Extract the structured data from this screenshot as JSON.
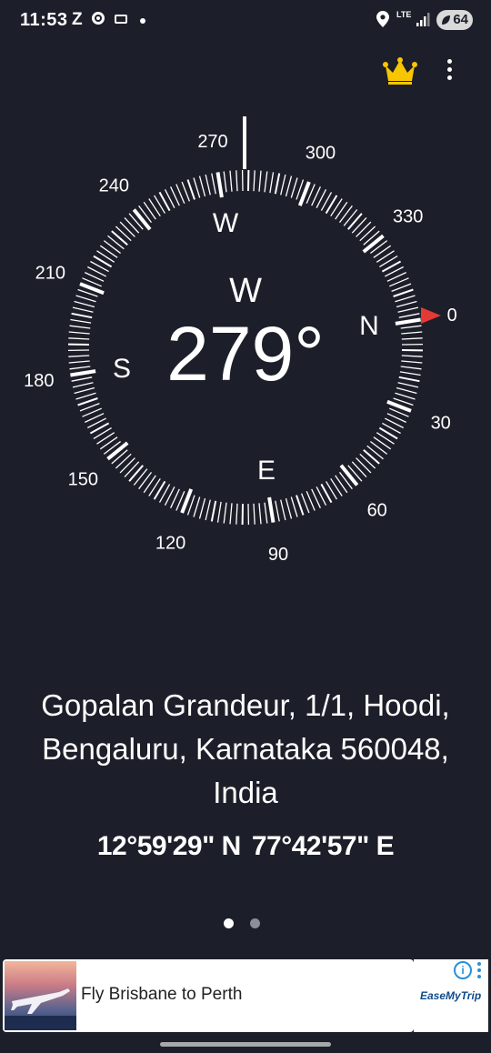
{
  "status_bar": {
    "time": "11:53",
    "carrier_letter": "Z",
    "network": "LTE",
    "battery": "64"
  },
  "toolbar": {
    "premium_icon": "crown-icon",
    "menu_icon": "more-vert-icon",
    "accent_color": "#f7c600"
  },
  "compass": {
    "heading_letter": "W",
    "heading_degrees": "279°",
    "heading_value": 279,
    "cardinals": {
      "north": "N",
      "east": "E",
      "south": "S",
      "west": "W"
    },
    "degree_labels": [
      "0",
      "30",
      "60",
      "90",
      "120",
      "150",
      "180",
      "210",
      "240",
      "270",
      "300",
      "330"
    ],
    "north_marker_color": "#e53935"
  },
  "location": {
    "address": "Gopalan Grandeur, 1/1, Hoodi, Bengaluru, Karnataka 560048, India",
    "latitude": "12°59'29\" N",
    "longitude": "77°42'57\" E"
  },
  "pager": {
    "pages": 2,
    "active": 1
  },
  "ad": {
    "text": "Fly Brisbane to Perth",
    "brand": "EaseMyTrip",
    "info_icon": "info-icon"
  }
}
